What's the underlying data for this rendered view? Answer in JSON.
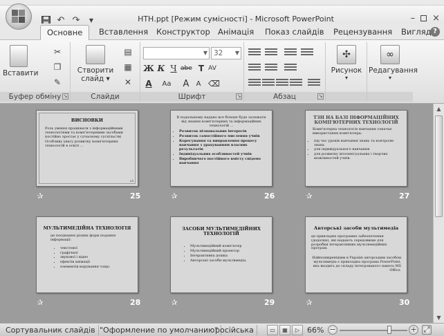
{
  "window": {
    "title": "НТН.ppt [Режим сумісності] - Microsoft PowerPoint",
    "min": "–",
    "close": "×"
  },
  "qat": {
    "save_icon": "save-icon",
    "undo": "↶",
    "redo": "↷"
  },
  "tabs": [
    {
      "label": "Основне",
      "active": true
    },
    {
      "label": "Вставлення"
    },
    {
      "label": "Конструктор"
    },
    {
      "label": "Анімація"
    },
    {
      "label": "Показ слайдів"
    },
    {
      "label": "Рецензування"
    },
    {
      "label": "Вигляд"
    }
  ],
  "help_label": "?",
  "ribbon": {
    "clipboard": {
      "paste": "Вставити",
      "group": "Буфер обміну"
    },
    "slides": {
      "new_slide_line1": "Створити",
      "new_slide_line2": "слайд",
      "group": "Слайди"
    },
    "font": {
      "size": "32",
      "bold": "Ж",
      "italic": "К",
      "underline": "Ч",
      "strike": "abe",
      "shadow": "T",
      "spacing": "AV",
      "color": "A",
      "case": "Aa",
      "grow": "A",
      "shrink": "A",
      "group": "Шрифт"
    },
    "paragraph": {
      "group": "Абзац"
    },
    "drawing": {
      "label": "Рисунок"
    },
    "editing": {
      "label": "Редагування"
    }
  },
  "slides": [
    {
      "num": "25",
      "title": "ВИСНОВКИ",
      "bullets": [
        "Роль уміння працювати з інформаційними технологіями та комп'ютерними засобами постійно зростає у сучасному суспільстві",
        "Особливу увагу розвитку комп'ютерних технологій в освіті ..."
      ]
    },
    {
      "num": "26",
      "title": "",
      "intro": "В подальшому надано все більше буде залежати від знання комп'ютерних та інформаційних технологій ...",
      "bullets": [
        "Розвиток пізнавальних інтересів",
        "Розвиток самостійного мислення учнів",
        "Корегування та виправлення процесу навчання з урахуванням власних результатів",
        "Індивідуальних особливостей учнів",
        "Виробничого постійного вмісту свідомо навчання"
      ]
    },
    {
      "num": "27",
      "title": "ТЗН НА БАЗІ ІНФОРМАЦІЙНИХ КОМП'ЮТЕРНИХ ТЕХНОЛОГІЙ",
      "intro": "Комп'ютерна технологія навчання означає використання комп'ютера:",
      "bullets": [
        "під час уроків навчання знань та контролю знань",
        "для індивідуального навчання",
        "для розвитку інтелектуальних і творчих можливостей учнів."
      ]
    },
    {
      "num": "28",
      "title": "МУЛЬТИМЕДІЙНА ТЕХНОЛОГІЯ",
      "intro": "це поєднання різних форм подання інформації:",
      "bullets": [
        "текстової",
        "графічної",
        "звукової і відео",
        "ефектів анімації",
        "елементів керування тощо."
      ]
    },
    {
      "num": "29",
      "title": "ЗАСОБИ МУЛЬТИМЕДІЙНИХ ТЕХНОЛОГІЙ",
      "bullets": [
        "Мультимедійний комп'ютер",
        "Мультимедійний проектор",
        "Інтерактивна дошка",
        "Авторські засоби мультимедіа."
      ]
    },
    {
      "num": "30",
      "title": "Авторські засоби мультимедіа",
      "intro": "це прикладне програмне забезпечення (додатки), які надають середовище для розробки інтерактивних мультимедійних програм.",
      "note": "Найпоширенішим в Україні авторським засобом мультимедіа є прикладна програма PowerPoint, яка входить до складу інтегрованого пакета MS Office."
    }
  ],
  "status": {
    "view": "Сортувальник слайдів",
    "theme": "\"Оформление по умолчанию\"",
    "language": "російська",
    "zoom": "66%",
    "zoom_fraction": 0.66
  }
}
